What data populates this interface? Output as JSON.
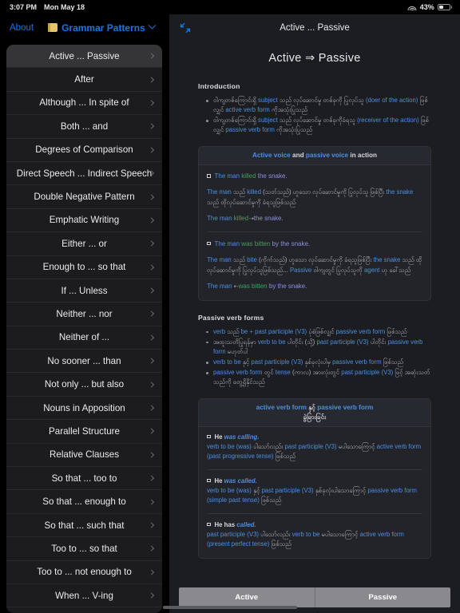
{
  "statusbar": {
    "time": "3:07 PM",
    "date": "Mon May 18",
    "battery_percent": "43%",
    "wifi_icon": "wifi-icon",
    "battery_icon": "battery-icon"
  },
  "sidebar": {
    "nav": {
      "about_label": "About",
      "folder_icon": "folder-icon",
      "collection_label": "Grammar Patterns",
      "chevron_icon": "chevron-down-icon"
    },
    "items": [
      {
        "label": "Active ... Passive",
        "selected": true
      },
      {
        "label": "After",
        "selected": false
      },
      {
        "label": "Although ... In spite of",
        "selected": false
      },
      {
        "label": "Both ... and",
        "selected": false
      },
      {
        "label": "Degrees of Comparison",
        "selected": false
      },
      {
        "label": "Direct Speech ... Indirect Speech",
        "selected": false
      },
      {
        "label": "Double Negative Pattern",
        "selected": false
      },
      {
        "label": "Emphatic Writing",
        "selected": false
      },
      {
        "label": "Either ... or",
        "selected": false
      },
      {
        "label": "Enough to ... so that",
        "selected": false
      },
      {
        "label": "If ... Unless",
        "selected": false
      },
      {
        "label": "Neither ... nor",
        "selected": false
      },
      {
        "label": "Neither of ...",
        "selected": false
      },
      {
        "label": "No sooner ... than",
        "selected": false
      },
      {
        "label": "Not only ... but also",
        "selected": false
      },
      {
        "label": "Nouns in Apposition",
        "selected": false
      },
      {
        "label": "Parallel Structure",
        "selected": false
      },
      {
        "label": "Relative Clauses",
        "selected": false
      },
      {
        "label": "So that ... too to",
        "selected": false
      },
      {
        "label": "So that ... enough to",
        "selected": false
      },
      {
        "label": "So that ... such that",
        "selected": false
      },
      {
        "label": "Too to ... so that",
        "selected": false
      },
      {
        "label": "Too to ... not enough to",
        "selected": false
      },
      {
        "label": "When ... V-ing",
        "selected": false
      }
    ]
  },
  "detail": {
    "topbar": {
      "expand_icon": "expand-collapse-icon",
      "title": "Active ... Passive"
    },
    "doc_title": "Active ⇒ Passive",
    "intro": {
      "heading": "Introduction",
      "bullets": [
        {
          "parts": [
            {
              "t": "ဝါကျတစ်ကြောင်းရှိ ",
              "c": "gy"
            },
            {
              "t": "subject",
              "c": "bl"
            },
            {
              "t": " သည် လုပ်ဆောင်မှု တစ်ခုကို ပြုလုပ်သူ ",
              "c": "gy"
            },
            {
              "t": "(doer of the action)",
              "c": "bl"
            },
            {
              "t": " ဖြစ်လျှင် ",
              "c": "gy"
            },
            {
              "t": "active verb form",
              "c": "bl"
            },
            {
              "t": " ကိုအသုံးပြုသည်",
              "c": "gy"
            }
          ]
        },
        {
          "parts": [
            {
              "t": "ဝါကျတစ်ကြောင်းရှိ ",
              "c": "gy"
            },
            {
              "t": "subject",
              "c": "bl"
            },
            {
              "t": " သည် လုပ်ဆောင်မှု တစ်ခုကိုခံရသူ ",
              "c": "gy"
            },
            {
              "t": "(receiver of the action)",
              "c": "bl"
            },
            {
              "t": " ဖြစ်လျှင် ",
              "c": "gy"
            },
            {
              "t": "passive verb form",
              "c": "bl"
            },
            {
              "t": " ကိုအသုံးပြုသည်",
              "c": "gy"
            }
          ]
        }
      ]
    },
    "card1": {
      "head": [
        {
          "t": "Active voice",
          "c": "bl"
        },
        {
          "t": " and ",
          "c": "wh"
        },
        {
          "t": "passive voice",
          "c": "bl"
        },
        {
          "t": " in action",
          "c": "wh"
        }
      ],
      "blocks": [
        {
          "example": [
            {
              "t": "The man ",
              "c": "bl"
            },
            {
              "t": "killed",
              "c": "gr"
            },
            {
              "t": " the snake.",
              "c": "pu"
            }
          ],
          "explanation": [
            {
              "t": "The man",
              "c": "bl"
            },
            {
              "t": " သည် ",
              "c": "gy"
            },
            {
              "t": "killed",
              "c": "bl"
            },
            {
              "t": " (သတ်သည်) ဟူသော လုပ်ဆောင်မှုကို ပြုလုပ်သူ ဖြစ်ပြီး ",
              "c": "gy"
            },
            {
              "t": "the snake",
              "c": "bl"
            },
            {
              "t": " သည် ထိုလုပ်ဆောင်မှုကို ခံရသူဖြစ်သည်",
              "c": "gy"
            }
          ],
          "result": [
            {
              "t": "The man ",
              "c": "bl"
            },
            {
              "t": "killed",
              "c": "gr"
            },
            {
              "t": " ⇢ ",
              "c": "arrow"
            },
            {
              "t": "the snake.",
              "c": "pu"
            }
          ]
        },
        {
          "example": [
            {
              "t": "The man ",
              "c": "bl"
            },
            {
              "t": "was bitten",
              "c": "gr"
            },
            {
              "t": " by the snake.",
              "c": "pu"
            }
          ],
          "explanation": [
            {
              "t": "The man",
              "c": "bl"
            },
            {
              "t": " သည် ",
              "c": "gy"
            },
            {
              "t": "bite",
              "c": "bl"
            },
            {
              "t": " (ကိုက်သည်) ဟူသော လုပ်ဆောင်မှုကို ခံရသူဖြစ်ပြီး ",
              "c": "gy"
            },
            {
              "t": "the snake",
              "c": "bl"
            },
            {
              "t": " သည် ထိုလုပ်ဆောင်မှုကို ပြုလုပ်သူဖြစ်သည်... ",
              "c": "gy"
            },
            {
              "t": "Passive",
              "c": "bl"
            },
            {
              "t": " ဝါကျတွင် ပြုလုပ်သူကို ",
              "c": "gy"
            },
            {
              "t": "agent",
              "c": "bl"
            },
            {
              "t": " ဟု ခေါ်သည်",
              "c": "gy"
            }
          ],
          "result": [
            {
              "t": "The man ",
              "c": "bl"
            },
            {
              "t": " ⇠ ",
              "c": "arrow"
            },
            {
              "t": "was bitten",
              "c": "gr"
            },
            {
              "t": " by the snake.",
              "c": "pu"
            }
          ]
        }
      ]
    },
    "passive_forms": {
      "heading": "Passive verb forms",
      "bullets": [
        {
          "parts": [
            {
              "t": "verb",
              "c": "bl"
            },
            {
              "t": " သည် ",
              "c": "gy"
            },
            {
              "t": "be + past participle (V3)",
              "c": "bl"
            },
            {
              "t": " ပုံစံဖြစ်လျှင် ",
              "c": "gy"
            },
            {
              "t": "passive verb form",
              "c": "bl"
            },
            {
              "t": " ဖြစ်သည်",
              "c": "gy"
            }
          ]
        },
        {
          "parts": [
            {
              "t": "အထူးသတိပြုရန်မှာ ",
              "c": "gy"
            },
            {
              "t": "verb to be",
              "c": "bl"
            },
            {
              "t": " ပါတိုင်း (သို့) ",
              "c": "gy"
            },
            {
              "t": "past participle (V3)",
              "c": "bl"
            },
            {
              "t": " ပါတိုင်း ",
              "c": "gy"
            },
            {
              "t": "passive verb form",
              "c": "bl"
            },
            {
              "t": " မဟုတ်ပါ",
              "c": "gy"
            }
          ]
        },
        {
          "parts": [
            {
              "t": "verb to be",
              "c": "bl"
            },
            {
              "t": " နှင့် ",
              "c": "gy"
            },
            {
              "t": "past participle (V3)",
              "c": "bl"
            },
            {
              "t": " နှစ်ခုလုံးပါမှ ",
              "c": "gy"
            },
            {
              "t": "passive verb form",
              "c": "bl"
            },
            {
              "t": " ဖြစ်သည်",
              "c": "gy"
            }
          ]
        },
        {
          "parts": [
            {
              "t": "passive verb form",
              "c": "bl"
            },
            {
              "t": " တွင် ",
              "c": "gy"
            },
            {
              "t": "tense",
              "c": "bl"
            },
            {
              "t": " (ကာလ) အားလုံးတွင် ",
              "c": "gy"
            },
            {
              "t": "past participle (V3)",
              "c": "bl"
            },
            {
              "t": " ဖြင့် အဆုံးသတ်သည်ကို တွေ့ရှိနိုင်သည်",
              "c": "gy"
            }
          ]
        }
      ]
    },
    "card2": {
      "head_line1": [
        {
          "t": "active verb form",
          "c": "bl"
        },
        {
          "t": " နှင့် ",
          "c": "wh"
        },
        {
          "t": "passive verb form",
          "c": "bl"
        }
      ],
      "head_line2": "ခွဲခြားခြင်း",
      "blocks": [
        {
          "example": [
            {
              "t": "He ",
              "c": "wh"
            },
            {
              "t": "was calling.",
              "c": "bl-ita"
            }
          ],
          "note": [
            {
              "t": "verb to be (was)",
              "c": "bl"
            },
            {
              "t": " ပါသော်လည်း ",
              "c": "gy"
            },
            {
              "t": "past participle (V3)",
              "c": "bl"
            },
            {
              "t": " မပါသောကြောင့် ",
              "c": "gy"
            },
            {
              "t": "active verb form (past progressive tense)",
              "c": "bl"
            },
            {
              "t": " ဖြစ်သည်",
              "c": "gy"
            }
          ]
        },
        {
          "example": [
            {
              "t": "He ",
              "c": "wh"
            },
            {
              "t": "was called.",
              "c": "bl-ita"
            }
          ],
          "note": [
            {
              "t": "verb to be (was)",
              "c": "bl"
            },
            {
              "t": " နှင့် ",
              "c": "gy"
            },
            {
              "t": "past participle (V3)",
              "c": "bl"
            },
            {
              "t": " နှစ်ခုလုံးပါသောကြောင့် ",
              "c": "gy"
            },
            {
              "t": "passive verb form (simple past tense)",
              "c": "bl"
            },
            {
              "t": " ဖြစ်သည်",
              "c": "gy"
            }
          ]
        },
        {
          "example": [
            {
              "t": "He has ",
              "c": "wh"
            },
            {
              "t": "called.",
              "c": "bl-ita"
            }
          ],
          "note": [
            {
              "t": "past participle (V3)",
              "c": "bl"
            },
            {
              "t": " ပါသော်လည်း ",
              "c": "gy"
            },
            {
              "t": "verb to be",
              "c": "bl"
            },
            {
              "t": " မပါသောကြောင့် ",
              "c": "gy"
            },
            {
              "t": "active verb form (present perfect tense)",
              "c": "bl"
            },
            {
              "t": " ဖြစ်သည်",
              "c": "gy"
            }
          ]
        }
      ]
    },
    "bottom_tabs": [
      {
        "label": "Active",
        "selected": true
      },
      {
        "label": "Passive",
        "selected": false
      }
    ]
  }
}
